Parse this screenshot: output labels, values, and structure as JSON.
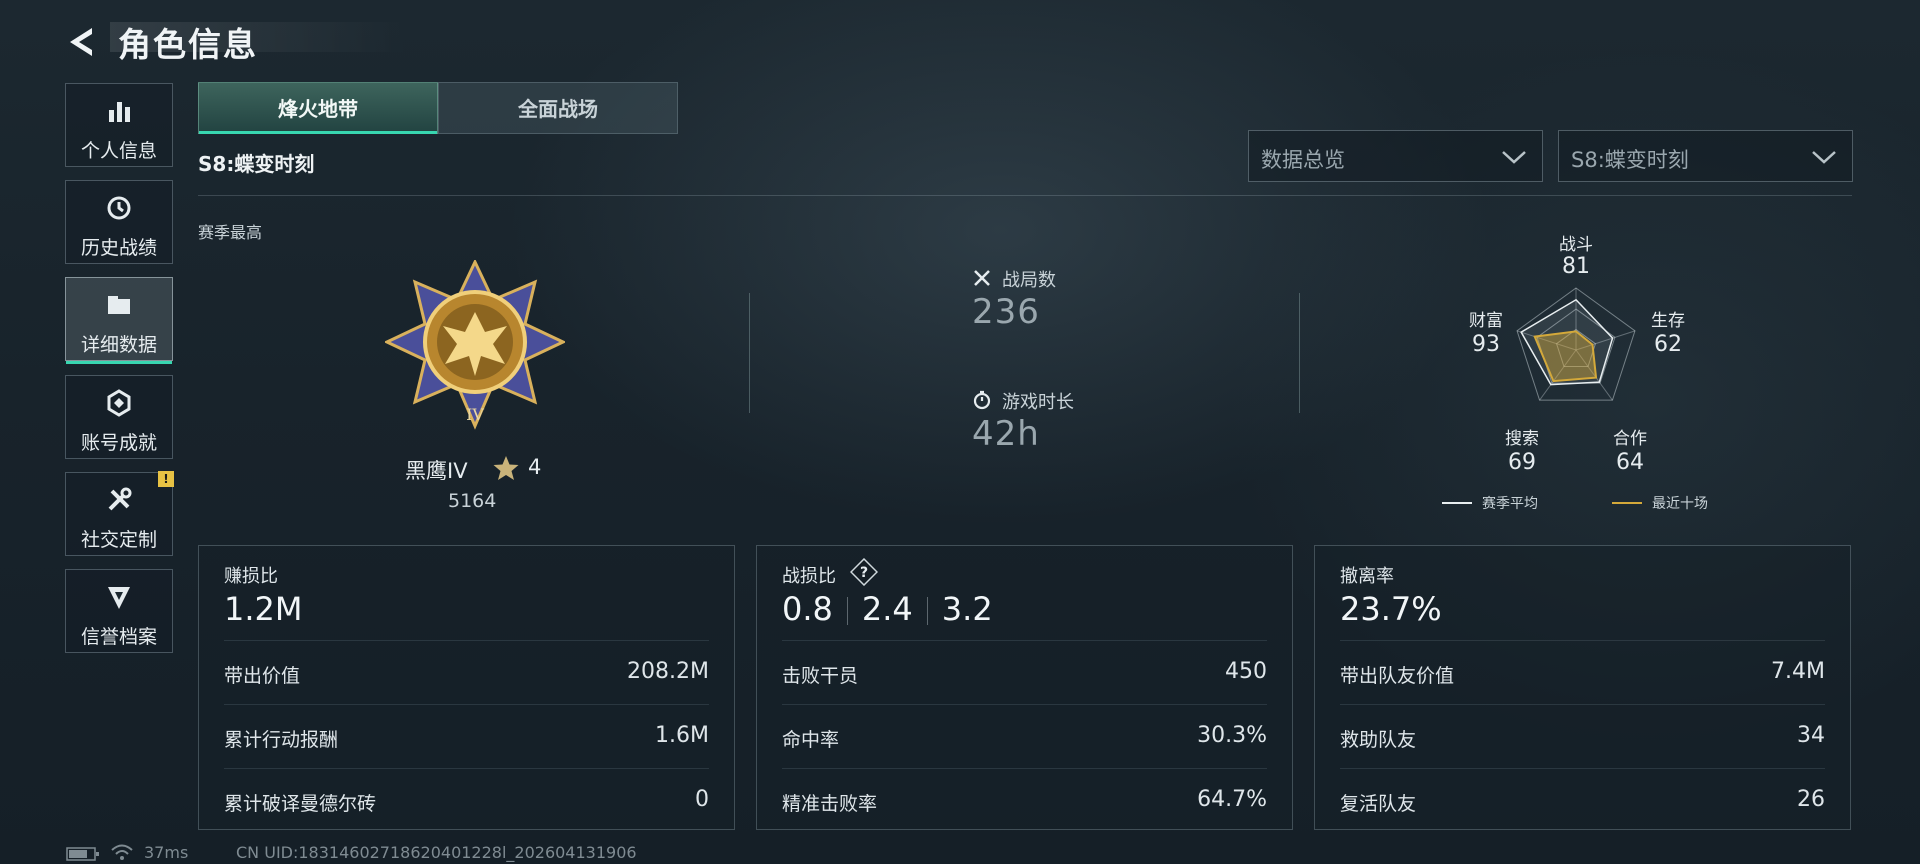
{
  "header": {
    "title": "角色信息"
  },
  "sidebar": {
    "items": [
      {
        "label": "个人信息",
        "icon": "bar-chart-icon",
        "active": false
      },
      {
        "label": "历史战绩",
        "icon": "history-icon",
        "active": false
      },
      {
        "label": "详细数据",
        "icon": "folder-icon",
        "active": true
      },
      {
        "label": "账号成就",
        "icon": "achievement-icon",
        "active": false
      },
      {
        "label": "社交定制",
        "icon": "tools-icon",
        "active": false,
        "badge": "!"
      },
      {
        "label": "信誉档案",
        "icon": "credit-icon",
        "active": false
      }
    ]
  },
  "tabs": [
    {
      "label": "烽火地带",
      "active": true
    },
    {
      "label": "全面战场",
      "active": false
    }
  ],
  "season_title": "S8:蝶变时刻",
  "dropdowns": {
    "view": "数据总览",
    "season": "S8:蝶变时刻"
  },
  "season_best": {
    "label": "赛季最高",
    "rank_name": "黑鹰IV",
    "stars": "4",
    "score": "5164",
    "medal_numeral": "IV"
  },
  "stats": {
    "matches": {
      "label": "战局数",
      "value": "236"
    },
    "playtime": {
      "label": "游戏时长",
      "value": "42h"
    }
  },
  "radar": {
    "axes": [
      {
        "label": "战斗",
        "value": "81"
      },
      {
        "label": "生存",
        "value": "62"
      },
      {
        "label": "合作",
        "value": "64"
      },
      {
        "label": "搜索",
        "value": "69"
      },
      {
        "label": "财富",
        "value": "93"
      }
    ],
    "recent_values": [
      0.3,
      0.28,
      0.55,
      0.62,
      0.7
    ],
    "legend": {
      "season_avg": "赛季平均",
      "recent": "最近十场"
    },
    "colors": {
      "season_avg": "#e8eef0",
      "recent": "#d4a93a"
    }
  },
  "cards": {
    "profit": {
      "title": "赚损比",
      "value": "1.2M",
      "rows": [
        {
          "label": "带出价值",
          "value": "208.2M"
        },
        {
          "label": "累计行动报酬",
          "value": "1.6M"
        },
        {
          "label": "累计破译曼德尔砖",
          "value": "0"
        }
      ]
    },
    "kd": {
      "title": "战损比",
      "values": [
        "0.8",
        "2.4",
        "3.2"
      ],
      "rows": [
        {
          "label": "击败干员",
          "value": "450"
        },
        {
          "label": "命中率",
          "value": "30.3%"
        },
        {
          "label": "精准击败率",
          "value": "64.7%"
        }
      ]
    },
    "extract": {
      "title": "撤离率",
      "value": "23.7%",
      "rows": [
        {
          "label": "带出队友价值",
          "value": "7.4M"
        },
        {
          "label": "救助队友",
          "value": "34"
        },
        {
          "label": "复活队友",
          "value": "26"
        }
      ]
    }
  },
  "footer": {
    "ping": "37ms",
    "uid": "CN UID:18314602718620401228l_202604131906"
  },
  "colors": {
    "accent": "#38d6b0",
    "badge": "#e7c244"
  }
}
